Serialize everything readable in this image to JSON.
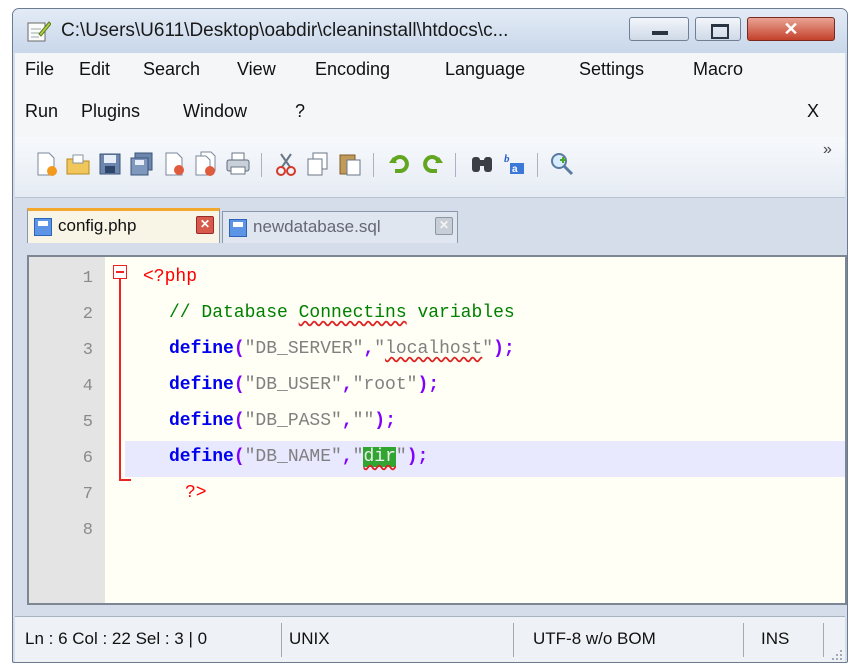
{
  "window": {
    "title": "C:\\Users\\U611\\Desktop\\oabdir\\cleaninstall\\htdocs\\c...",
    "buttons": {
      "close": "✕"
    }
  },
  "menu": {
    "row1": [
      "File",
      "Edit",
      "Search",
      "View",
      "Encoding",
      "Language",
      "Settings",
      "Macro"
    ],
    "row2": [
      "Run",
      "Plugins",
      "Window",
      "?"
    ],
    "close_x": "X"
  },
  "toolbar": {
    "icons": [
      "new-file-icon",
      "open-file-icon",
      "save-icon",
      "save-all-icon",
      "close-icon",
      "close-all-icon",
      "print-icon",
      "cut-icon",
      "copy-icon",
      "paste-icon",
      "undo-icon",
      "redo-icon",
      "find-icon",
      "replace-icon",
      "zoom-in-icon"
    ],
    "overflow": "»"
  },
  "tabs": [
    {
      "label": "config.php",
      "active": true,
      "close": "✕"
    },
    {
      "label": "newdatabase.sql",
      "active": false,
      "close": "✕"
    }
  ],
  "editor": {
    "line_numbers": [
      "1",
      "2",
      "3",
      "4",
      "5",
      "6",
      "7",
      "8"
    ],
    "current_line": 6
  },
  "status": {
    "position": "Ln : 6    Col : 22    Sel : 3 | 0",
    "eol": "UNIX",
    "encoding": "UTF-8 w/o BOM",
    "mode": "INS"
  },
  "colors": {
    "keyword": "#0000ee",
    "punct": "#8000ff",
    "string": "#808080",
    "comment": "#008000",
    "php_tag": "#ff0000",
    "active_tab": "#f3a72c",
    "current_line_bg": "#e8e8ff"
  }
}
